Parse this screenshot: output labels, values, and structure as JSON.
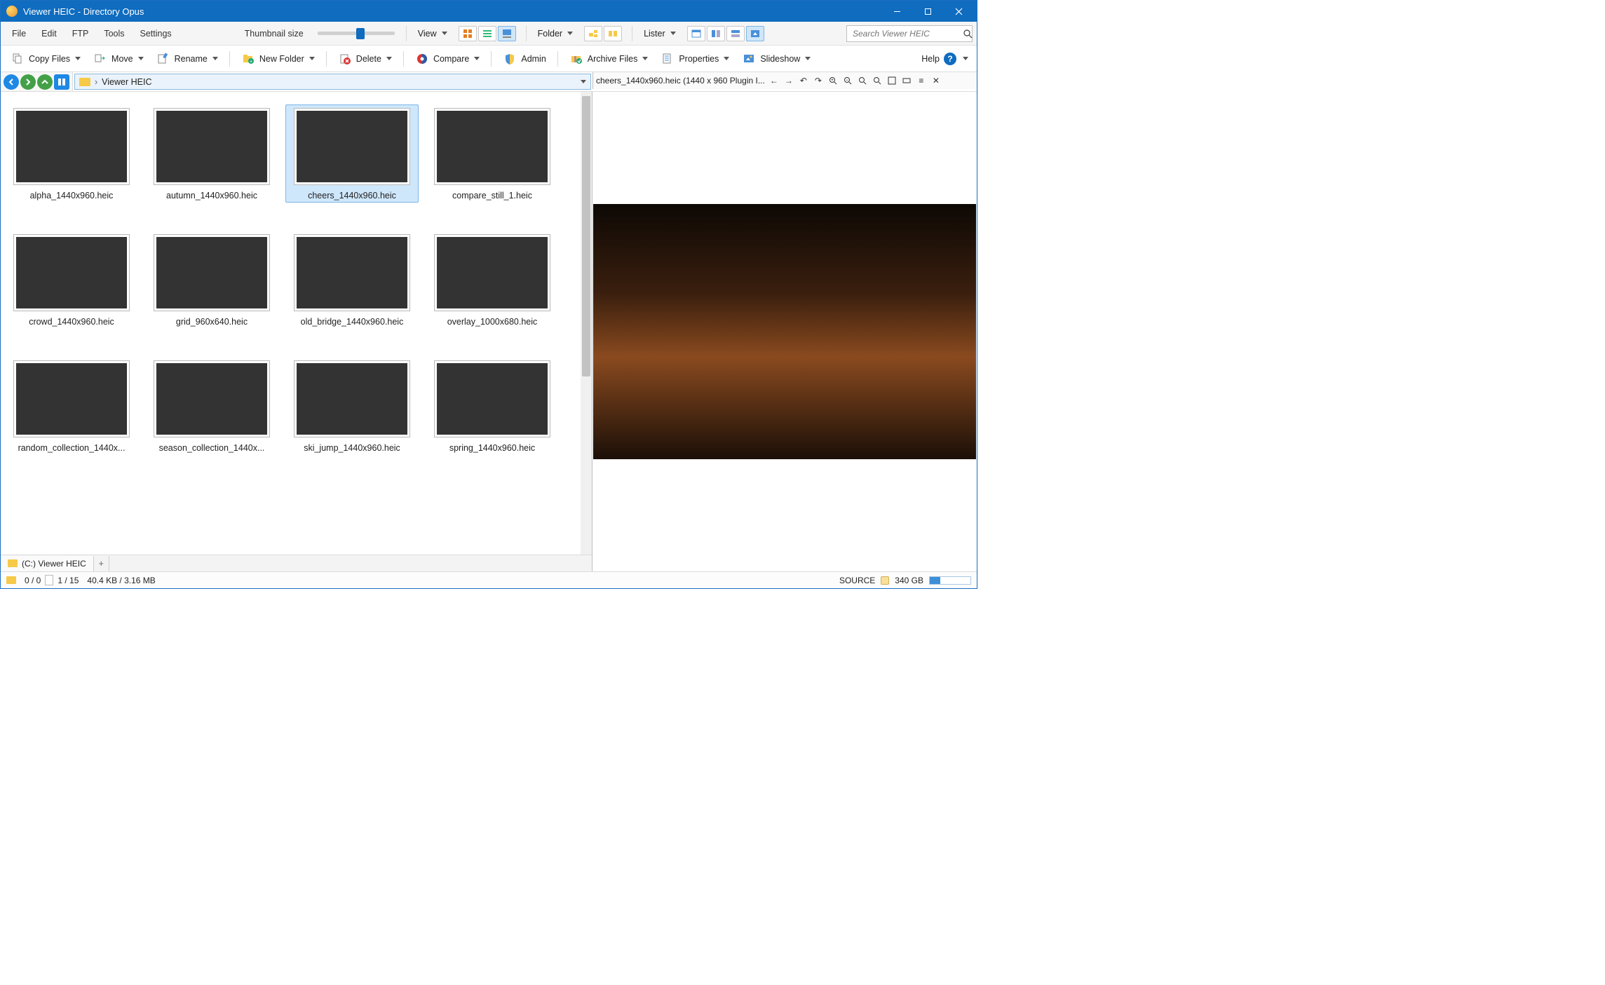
{
  "title": "Viewer HEIC - Directory Opus",
  "menus": {
    "file": "File",
    "edit": "Edit",
    "ftp": "FTP",
    "tools": "Tools",
    "settings": "Settings"
  },
  "thumb_label": "Thumbnail size",
  "view_label": "View",
  "folder_label": "Folder",
  "lister_label": "Lister",
  "search": {
    "placeholder": "Search Viewer HEIC"
  },
  "toolbar": {
    "copy": "Copy Files",
    "move": "Move",
    "rename": "Rename",
    "newfolder": "New Folder",
    "delete": "Delete",
    "compare": "Compare",
    "admin": "Admin",
    "archive": "Archive Files",
    "properties": "Properties",
    "slideshow": "Slideshow",
    "help": "Help"
  },
  "path": {
    "folder": "Viewer HEIC"
  },
  "files": [
    {
      "name": "alpha_1440x960.heic",
      "cls": "img-mountain"
    },
    {
      "name": "autumn_1440x960.heic",
      "cls": "img-autumn"
    },
    {
      "name": "cheers_1440x960.heic",
      "cls": "img-night-street",
      "selected": true
    },
    {
      "name": "compare_still_1.heic",
      "cls": "img-night-street"
    },
    {
      "name": "crowd_1440x960.heic",
      "cls": "img-crowd"
    },
    {
      "name": "grid_960x640.heic",
      "cls": "img-grid"
    },
    {
      "name": "old_bridge_1440x960.heic",
      "cls": "img-bridge"
    },
    {
      "name": "overlay_1000x680.heic",
      "cls": "img-overlay"
    },
    {
      "name": "random_collection_1440x...",
      "cls": "img-night-street"
    },
    {
      "name": "season_collection_1440x...",
      "cls": "img-mountain"
    },
    {
      "name": "ski_jump_1440x960.heic",
      "cls": "img-sky"
    },
    {
      "name": "spring_1440x960.heic",
      "cls": "img-spring"
    }
  ],
  "preview": {
    "title": "cheers_1440x960.heic (1440 x 960 Plugin I..."
  },
  "tabs": {
    "t0": "(C:) Viewer HEIC"
  },
  "status": {
    "sel": "0 / 0",
    "count": "1 / 15",
    "size": "40.4 KB / 3.16 MB",
    "source": "SOURCE",
    "disk": "340 GB"
  }
}
